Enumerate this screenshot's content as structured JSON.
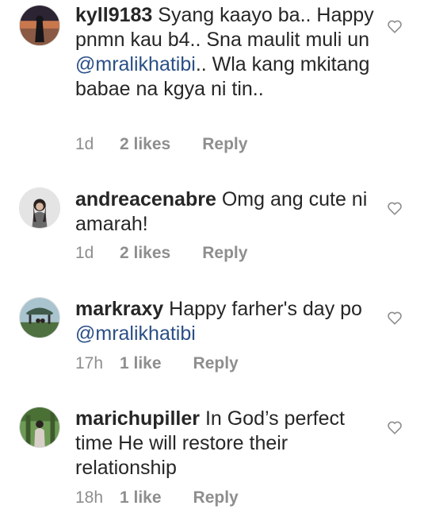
{
  "comments": [
    {
      "username": "kyll9183",
      "text_before": " Syang kaayo ba.. Happy pnmn kau b4.. Sna maulit muli un ",
      "mention": "@mralikhatibi",
      "text_after": ".. Wla kang mkitang babae na kgya ni tin..",
      "time": "1d",
      "likes": "2 likes",
      "reply_label": "Reply",
      "avatar_colors": [
        "#3a2a3a",
        "#d98a5a"
      ]
    },
    {
      "username": "andreacenabre",
      "text_before": " Omg ang cute ni amarah!",
      "mention": "",
      "text_after": "",
      "time": "1d",
      "likes": "2 likes",
      "reply_label": "Reply",
      "avatar_colors": [
        "#d8d8d8",
        "#3a3230"
      ]
    },
    {
      "username": "markraxy",
      "text_before": " Happy farher's day po ",
      "mention": "@mralikhatibi",
      "text_after": "",
      "time": "17h",
      "likes": "1 like",
      "reply_label": "Reply",
      "avatar_colors": [
        "#9cb7c4",
        "#4a6a3a"
      ]
    },
    {
      "username": "marichupiller",
      "text_before": " In God’s perfect time He will restore their relationship",
      "mention": "",
      "text_after": "",
      "time": "18h",
      "likes": "1 like",
      "reply_label": "Reply",
      "avatar_colors": [
        "#5f8a4a",
        "#2c3e25"
      ]
    }
  ],
  "colors": {
    "text": "#262626",
    "mention": "#2b4f86",
    "meta": "#8e8e8e"
  }
}
